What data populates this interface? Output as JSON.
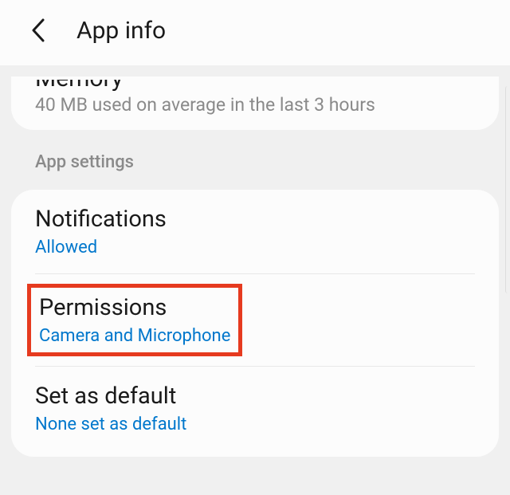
{
  "header": {
    "title": "App info"
  },
  "memory": {
    "title": "Memory",
    "subtext": "40 MB used on average in the last 3 hours"
  },
  "section_header": "App settings",
  "rows": {
    "notifications": {
      "title": "Notifications",
      "sub": "Allowed"
    },
    "permissions": {
      "title": "Permissions",
      "sub": "Camera and Microphone"
    },
    "set_default": {
      "title": "Set as default",
      "sub": "None set as default"
    }
  }
}
